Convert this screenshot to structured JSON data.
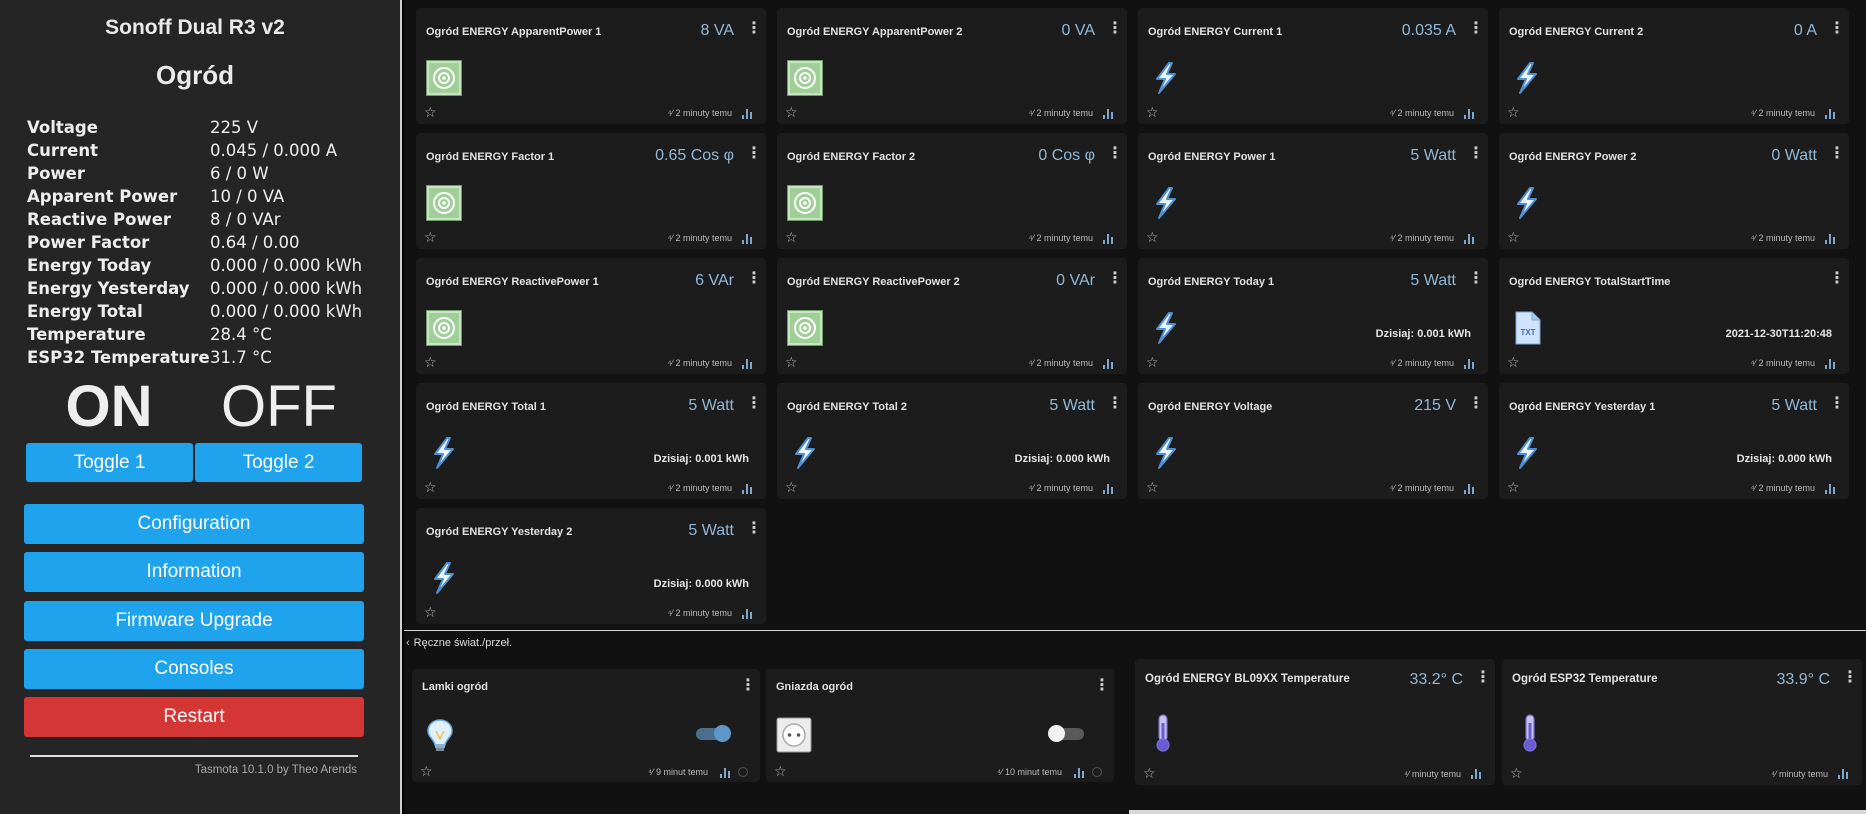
{
  "tasmota": {
    "title": "Sonoff Dual R3 v2",
    "device_name": "Ogród",
    "sensors": [
      {
        "label": "Voltage",
        "value": "225 V"
      },
      {
        "label": "Current",
        "value": "0.045 / 0.000 A"
      },
      {
        "label": "Power",
        "value": "6 / 0 W"
      },
      {
        "label": "Apparent Power",
        "value": "10 / 0 VA"
      },
      {
        "label": "Reactive Power",
        "value": "8 / 0 VAr"
      },
      {
        "label": "Power Factor",
        "value": "0.64 / 0.00"
      },
      {
        "label": "Energy Today",
        "value": "0.000 / 0.000 kWh"
      },
      {
        "label": "Energy Yesterday",
        "value": "0.000 / 0.000 kWh"
      },
      {
        "label": "Energy Total",
        "value": "0.000 / 0.000 kWh"
      },
      {
        "label": "Temperature",
        "value": "28.4 °C"
      },
      {
        "label": "ESP32 Temperature",
        "value": "31.7 °C"
      }
    ],
    "state1": "ON",
    "state2": "OFF",
    "toggle1": "Toggle 1",
    "toggle2": "Toggle 2",
    "menu": [
      "Configuration",
      "Information",
      "Firmware Upgrade",
      "Consoles",
      "Restart"
    ],
    "footer": "Tasmota 10.1.0 by Theo Arends"
  },
  "colors": {
    "tasmota_button": "#1fa3ec",
    "restart_button": "#d43535",
    "value_blue": "#90b8d8",
    "card_bg": "#1c1c1c"
  },
  "cards": [
    {
      "title": "Ogród ENERGY ApparentPower 1",
      "value": "8 VA",
      "icon": "meter-icon",
      "detail": "",
      "time": "2 minuty temu"
    },
    {
      "title": "Ogród ENERGY ApparentPower 2",
      "value": "0 VA",
      "icon": "meter-icon",
      "detail": "",
      "time": "2 minuty temu"
    },
    {
      "title": "Ogród ENERGY Current 1",
      "value": "0.035 A",
      "icon": "bolt-icon",
      "detail": "",
      "time": "2 minuty temu"
    },
    {
      "title": "Ogród ENERGY Current 2",
      "value": "0 A",
      "icon": "bolt-icon",
      "detail": "",
      "time": "2 minuty temu"
    },
    {
      "title": "Ogród ENERGY Factor 1",
      "value": "0.65 Cos φ",
      "icon": "meter-icon",
      "detail": "",
      "time": "2 minuty temu"
    },
    {
      "title": "Ogród ENERGY Factor 2",
      "value": "0 Cos φ",
      "icon": "meter-icon",
      "detail": "",
      "time": "2 minuty temu"
    },
    {
      "title": "Ogród ENERGY Power 1",
      "value": "5 Watt",
      "icon": "bolt-icon",
      "detail": "",
      "time": "2 minuty temu"
    },
    {
      "title": "Ogród ENERGY Power 2",
      "value": "0 Watt",
      "icon": "bolt-icon",
      "detail": "",
      "time": "2 minuty temu"
    },
    {
      "title": "Ogród ENERGY ReactivePower 1",
      "value": "6 VAr",
      "icon": "meter-icon",
      "detail": "",
      "time": "2 minuty temu"
    },
    {
      "title": "Ogród ENERGY ReactivePower 2",
      "value": "0 VAr",
      "icon": "meter-icon",
      "detail": "",
      "time": "2 minuty temu"
    },
    {
      "title": "Ogród ENERGY Today 1",
      "value": "5 Watt",
      "icon": "bolt-icon",
      "detail": "Dzisiaj: 0.001 kWh",
      "time": "2 minuty temu"
    },
    {
      "title": "Ogród ENERGY TotalStartTime",
      "value": "",
      "icon": "txt-file-icon",
      "detail": "2021-12-30T11:20:48",
      "time": "2 minuty temu"
    },
    {
      "title": "Ogród ENERGY Total 1",
      "value": "5 Watt",
      "icon": "bolt-icon",
      "detail": "Dzisiaj: 0.001 kWh",
      "time": "2 minuty temu"
    },
    {
      "title": "Ogród ENERGY Total 2",
      "value": "5 Watt",
      "icon": "bolt-icon",
      "detail": "Dzisiaj: 0.000 kWh",
      "time": "2 minuty temu"
    },
    {
      "title": "Ogród ENERGY Voltage",
      "value": "215 V",
      "icon": "bolt-icon",
      "detail": "",
      "time": "2 minuty temu"
    },
    {
      "title": "Ogród ENERGY Yesterday 1",
      "value": "5 Watt",
      "icon": "bolt-icon",
      "detail": "Dzisiaj: 0.000 kWh",
      "time": "2 minuty temu"
    },
    {
      "title": "Ogród ENERGY Yesterday 2",
      "value": "5 Watt",
      "icon": "bolt-icon",
      "detail": "Dzisiaj: 0.000 kWh",
      "time": "2 minuty temu"
    }
  ],
  "section": {
    "title": "Ręczne świat./przeł."
  },
  "switches": [
    {
      "title": "Lamki ogród",
      "icon": "lightbulb-icon",
      "on": true,
      "time": "9 minut temu"
    },
    {
      "title": "Gniazda ogród",
      "icon": "socket-icon",
      "on": false,
      "time": "10 minut temu"
    }
  ],
  "temps": [
    {
      "title": "Ogród ENERGY BL09XX Temperature",
      "value": "33.2° C",
      "icon": "thermometer-icon",
      "time": "minuty temu"
    },
    {
      "title": "Ogród ESP32 Temperature",
      "value": "33.9° C",
      "icon": "thermometer-icon",
      "time": "minuty temu"
    }
  ]
}
